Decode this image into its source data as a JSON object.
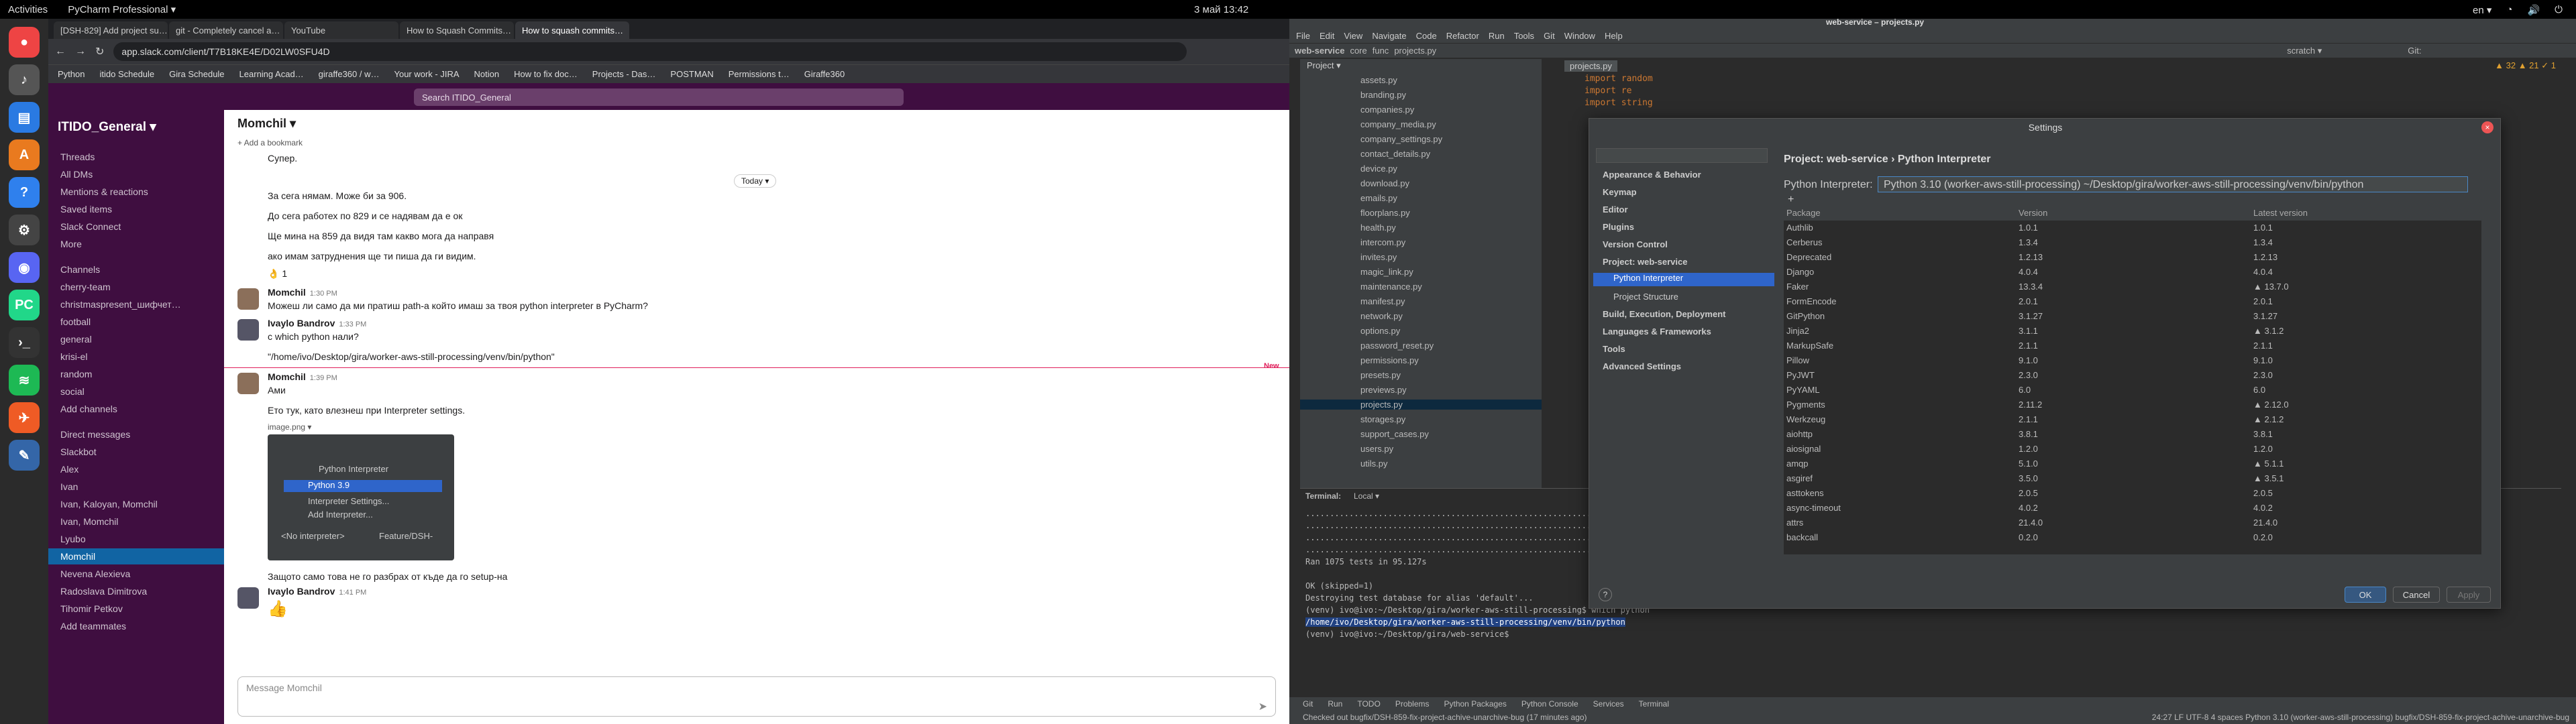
{
  "topbar": {
    "activities": "Activities",
    "app": "PyCharm Professional ▾",
    "clock": "3 май  13:42",
    "lang": "en ▾"
  },
  "browser": {
    "tabs": [
      "[DSH-829] Add project su…",
      "git - Completely cancel a…",
      "YouTube",
      "How to Squash Commits…",
      "How to squash commits…"
    ],
    "url": "app.slack.com/client/T7B18KE4E/D02LW0SFU4D",
    "bookmarks": [
      "Python",
      "itido Schedule",
      "Gira Schedule",
      "Learning Acad…",
      "giraffe360 / w…",
      "Your work - JIRA",
      "Notion",
      "How to fix doc…",
      "Projects - Das…",
      "POSTMAN",
      "Permissions t…",
      "Giraffe360"
    ]
  },
  "slack": {
    "search": "Search ITIDO_General",
    "workspace": "ITIDO_General ▾",
    "nav": [
      "Threads",
      "All DMs",
      "Mentions & reactions",
      "Saved items",
      "Slack Connect",
      "More"
    ],
    "channels_header": "Channels",
    "channels": [
      "cherry-team",
      "christmaspresent_шифчет…",
      "football",
      "general",
      "krisi-el",
      "random",
      "social"
    ],
    "add_channels": "Add channels",
    "dm_header": "Direct messages",
    "dms": [
      "Slackbot",
      "Alex",
      "Ivan",
      "Ivan, Kaloyan, Momchil",
      "Ivan, Momchil",
      "Lyubo",
      "Momchil",
      "Nevena Alexieva",
      "Radoslava Dimitrova",
      "Tihomir Petkov"
    ],
    "add_teammates": "Add teammates",
    "channel_title": "Momchil ▾",
    "bookmark": "+ Add a bookmark",
    "today": "Today ▾",
    "new_label": "New",
    "messages": [
      {
        "text": "Супер."
      },
      {
        "text": "За сега нямам. Може би за 906."
      },
      {
        "text": "До сега работех по 829 и се надявам да е ок"
      },
      {
        "text": "Ще мина на 859 да видя там какво мога да направя"
      },
      {
        "text": "ако имам затруднения ще ти пиша да ги видим."
      },
      {
        "text": "👌 1"
      },
      {
        "author": "Momchil",
        "time": "1:30 PM",
        "text": "Можеш ли само да ми пратиш path-а който имаш за твоя python interpreter в PyCharm?"
      },
      {
        "author": "Ivaylo Bandrov",
        "time": "1:33 PM",
        "text": "с which python  нали?"
      },
      {
        "text": "\"/home/ivo/Desktop/gira/worker-aws-still-processing/venv/bin/python\""
      },
      {
        "author": "Momchil",
        "time": "1:39 PM",
        "text": "Ами"
      },
      {
        "text": "Ето тук, като влезнеш при Interpreter settings."
      },
      {
        "text": "image.png ▾"
      },
      {
        "text": "Защото само това не го разбрах от къде да го setup-на"
      },
      {
        "author": "Ivaylo Bandrov",
        "time": "1:41 PM",
        "text": "👍"
      }
    ],
    "image_menu": [
      "Python Interpreter",
      "Python 3.9",
      "Interpreter Settings...",
      "Add Interpreter...",
      "<No interpreter>",
      "Feature/DSH-"
    ],
    "composer_placeholder": "Message Momchil"
  },
  "ide": {
    "title": "web-service – projects.py",
    "menu": [
      "File",
      "Edit",
      "View",
      "Navigate",
      "Code",
      "Refactor",
      "Run",
      "Tools",
      "Git",
      "Window",
      "Help"
    ],
    "nav": [
      "web-service",
      "core",
      "func",
      "projects.py"
    ],
    "run_config": "scratch ▾",
    "git_label": "Git:",
    "project_label": "Project ▾",
    "editor_tab": "projects.py",
    "code": [
      "import random",
      "import re",
      "import string"
    ],
    "files": [
      "assets.py",
      "branding.py",
      "companies.py",
      "company_media.py",
      "company_settings.py",
      "contact_details.py",
      "device.py",
      "download.py",
      "emails.py",
      "floorplans.py",
      "health.py",
      "intercom.py",
      "invites.py",
      "magic_link.py",
      "maintenance.py",
      "manifest.py",
      "network.py",
      "options.py",
      "password_reset.py",
      "permissions.py",
      "presets.py",
      "previews.py",
      "projects.py",
      "storages.py",
      "support_cases.py",
      "users.py",
      "utils.py"
    ],
    "terminal_tabs": [
      "Terminal:",
      "Local ▾"
    ],
    "terminal": [
      "......................................................................",
      "......................................................................",
      "......................................................................",
      "......................................................................",
      "Ran 1075 tests in 95.127s",
      "",
      "OK (skipped=1)",
      "Destroying test database for alias 'default'...",
      "(venv) ivo@ivo:~/Desktop/gira/worker-aws-still-processing$ which python",
      "/home/ivo/Desktop/gira/worker-aws-still-processing/venv/bin/python",
      "(venv) ivo@ivo:~/Desktop/gira/web-service$ "
    ],
    "bottom_tabs": [
      "Git",
      "Run",
      "TODO",
      "Problems",
      "Python Packages",
      "Python Console",
      "Services",
      "Terminal"
    ],
    "status_left": "Checked out bugfix/DSH-859-fix-project-achive-unarchive-bug (17 minutes ago)",
    "status_right": "24:27  LF  UTF-8  4 spaces  Python 3.10 (worker-aws-still-processing)  bugfix/DSH-859-fix-project-achive-unarchive-bug",
    "inspections": "▲ 32  ▲ 21  ✓ 1"
  },
  "settings": {
    "title": "Settings",
    "breadcrumb": "Project: web-service  ›  Python Interpreter",
    "interp_label": "Python Interpreter:",
    "interp_value": "Python 3.10 (worker-aws-still-processing)  ~/Desktop/gira/worker-aws-still-processing/venv/bin/python",
    "tree": [
      "Appearance & Behavior",
      "Keymap",
      "Editor",
      "Plugins",
      "Version Control",
      "Project: web-service",
      "Python Interpreter",
      "Project Structure",
      "Build, Execution, Deployment",
      "Languages & Frameworks",
      "Tools",
      "Advanced Settings"
    ],
    "headers": [
      "Package",
      "Version",
      "Latest version"
    ],
    "packages": [
      [
        "Authlib",
        "1.0.1",
        "1.0.1"
      ],
      [
        "Cerberus",
        "1.3.4",
        "1.3.4"
      ],
      [
        "Deprecated",
        "1.2.13",
        "1.2.13"
      ],
      [
        "Django",
        "4.0.4",
        "4.0.4"
      ],
      [
        "Faker",
        "13.3.4",
        "▲ 13.7.0"
      ],
      [
        "FormEncode",
        "2.0.1",
        "2.0.1"
      ],
      [
        "GitPython",
        "3.1.27",
        "3.1.27"
      ],
      [
        "Jinja2",
        "3.1.1",
        "▲ 3.1.2"
      ],
      [
        "MarkupSafe",
        "2.1.1",
        "2.1.1"
      ],
      [
        "Pillow",
        "9.1.0",
        "9.1.0"
      ],
      [
        "PyJWT",
        "2.3.0",
        "2.3.0"
      ],
      [
        "PyYAML",
        "6.0",
        "6.0"
      ],
      [
        "Pygments",
        "2.11.2",
        "▲ 2.12.0"
      ],
      [
        "Werkzeug",
        "2.1.1",
        "▲ 2.1.2"
      ],
      [
        "aiohttp",
        "3.8.1",
        "3.8.1"
      ],
      [
        "aiosignal",
        "1.2.0",
        "1.2.0"
      ],
      [
        "amqp",
        "5.1.0",
        "▲ 5.1.1"
      ],
      [
        "asgiref",
        "3.5.0",
        "▲ 3.5.1"
      ],
      [
        "asttokens",
        "2.0.5",
        "2.0.5"
      ],
      [
        "async-timeout",
        "4.0.2",
        "4.0.2"
      ],
      [
        "attrs",
        "21.4.0",
        "21.4.0"
      ],
      [
        "backcall",
        "0.2.0",
        "0.2.0"
      ]
    ],
    "ok": "OK",
    "cancel": "Cancel",
    "apply": "Apply",
    "help": "?"
  }
}
